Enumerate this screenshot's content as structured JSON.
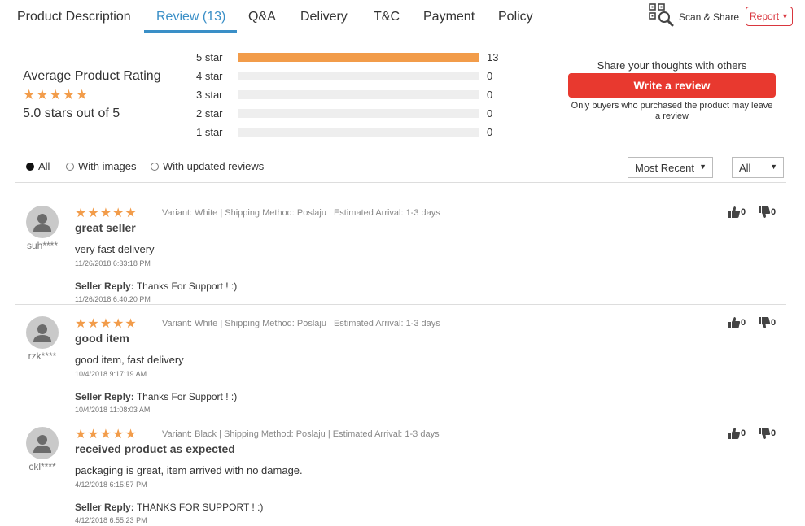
{
  "tabs": [
    {
      "label": "Product Description",
      "active": false
    },
    {
      "label": "Review (13)",
      "active": true
    },
    {
      "label": "Q&A",
      "active": false
    },
    {
      "label": "Delivery",
      "active": false
    },
    {
      "label": "T&C",
      "active": false
    },
    {
      "label": "Payment",
      "active": false
    },
    {
      "label": "Policy",
      "active": false
    }
  ],
  "scan_share": {
    "label": "Scan & Share",
    "icon": "qr-magnifier-icon"
  },
  "report": {
    "label": "Report",
    "icon": "caret-down-icon"
  },
  "summary": {
    "avg_label": "Average Product Rating",
    "stars": "★★★★★",
    "avg_text": "5.0 stars out of 5"
  },
  "distribution": [
    {
      "label": "5 star",
      "count": "13",
      "fraction": 1.0
    },
    {
      "label": "4 star",
      "count": "0",
      "fraction": 0
    },
    {
      "label": "3 star",
      "count": "0",
      "fraction": 0
    },
    {
      "label": "2 star",
      "count": "0",
      "fraction": 0
    },
    {
      "label": "1 star",
      "count": "0",
      "fraction": 0
    }
  ],
  "share": {
    "text": "Share your thoughts with others",
    "button": "Write a review",
    "note": "Only buyers who purchased the product may leave a review"
  },
  "filters": {
    "options": [
      {
        "label": "All",
        "checked": true
      },
      {
        "label": "With images",
        "checked": false
      },
      {
        "label": "With updated reviews",
        "checked": false
      }
    ],
    "sort": "Most Recent",
    "rating": "All"
  },
  "reviews": [
    {
      "user": "suh****",
      "stars": "★★★★★",
      "variant": "Variant: White | Shipping Method: Poslaju | Estimated Arrival: 1-3 days",
      "title": "great seller",
      "body": "very fast delivery",
      "date": "11/26/2018 6:33:18 PM",
      "seller_label": "Seller Reply:",
      "seller_reply": " Thanks For Support ! :)",
      "seller_date": "11/26/2018 6:40:20 PM",
      "likes": "0",
      "dislikes": "0"
    },
    {
      "user": "rzk****",
      "stars": "★★★★★",
      "variant": "Variant: White | Shipping Method: Poslaju | Estimated Arrival: 1-3 days",
      "title": "good item",
      "body": "good item, fast delivery",
      "date": "10/4/2018 9:17:19 AM",
      "seller_label": "Seller Reply:",
      "seller_reply": " Thanks For Support ! :)",
      "seller_date": "10/4/2018 11:08:03 AM",
      "likes": "0",
      "dislikes": "0"
    },
    {
      "user": "ckl****",
      "stars": "★★★★★",
      "variant": "Variant: Black | Shipping Method: Poslaju | Estimated Arrival: 1-3 days",
      "title": "received product as expected",
      "body": "packaging is great, item arrived with no damage.",
      "date": "4/12/2018 6:15:57 PM",
      "seller_label": "Seller Reply:",
      "seller_reply": " THANKS FOR SUPPORT ! :)",
      "seller_date": "4/12/2018 6:55:23 PM",
      "likes": "0",
      "dislikes": "0"
    }
  ],
  "colors": {
    "accent": "#3a8fc7",
    "star": "#f29c4a",
    "cta": "#e8392f",
    "report": "#d9363e"
  }
}
